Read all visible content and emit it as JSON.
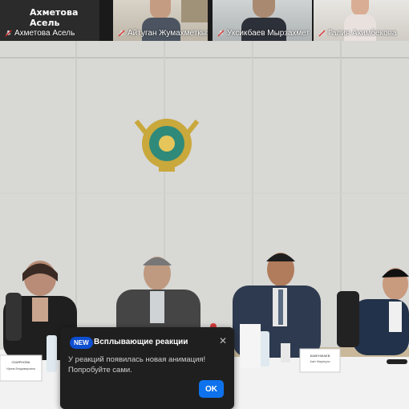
{
  "gallery": {
    "tiles": [
      {
        "name": "Ахметова Асель"
      },
      {
        "name": "Айтуган Жумахметкызы"
      },
      {
        "name": "Уксикбаев Мырзахмет ..."
      },
      {
        "name": "Галия Акимбекова"
      }
    ],
    "active_speaker_name": "Ахметова Асель"
  },
  "name_plates": [
    {
      "name": "СМИРНОВА",
      "sub": "Ирина Владимировна"
    },
    {
      "name": "БАКЕНЖАЕВ",
      "sub": "Азат Маратұлы"
    }
  ],
  "toast": {
    "badge": "NEW",
    "title": "Всплывающие реакции",
    "body": "У реакций появилась новая анимация! Попробуйте сами.",
    "ok_label": "OK"
  },
  "colors": {
    "toast_bg": "#1f1f1f",
    "badge": "#0e4fd1",
    "ok_button": "#0e72ed",
    "mic_muted": "#e02828"
  },
  "icons": {
    "mic": "muted-microphone-icon",
    "close": "close-icon",
    "emblem": "state-emblem"
  }
}
